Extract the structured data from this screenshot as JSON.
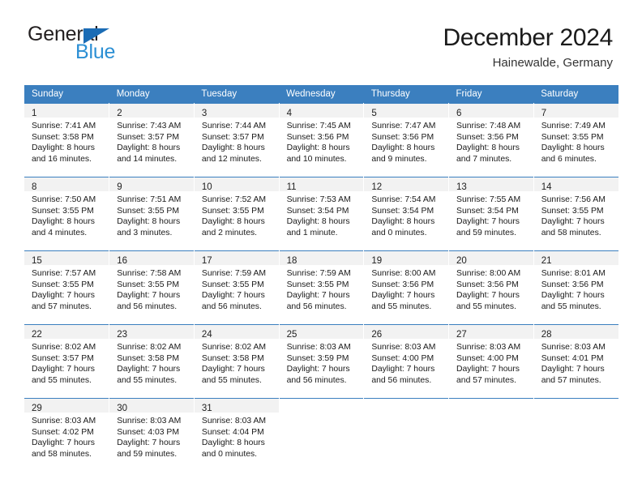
{
  "brand": {
    "name_part1": "General",
    "name_part2": "Blue"
  },
  "header": {
    "title": "December 2024",
    "subtitle": "Hainewalde, Germany"
  },
  "colors": {
    "header_blue": "#3b7fbf",
    "logo_blue": "#2b8fd4",
    "triangle_blue": "#1b6cb5",
    "daynum_strip": "#f2f2f2"
  },
  "weekday_headers": [
    "Sunday",
    "Monday",
    "Tuesday",
    "Wednesday",
    "Thursday",
    "Friday",
    "Saturday"
  ],
  "weeks": [
    [
      {
        "day": "1",
        "sunrise": "Sunrise: 7:41 AM",
        "sunset": "Sunset: 3:58 PM",
        "daylight1": "Daylight: 8 hours",
        "daylight2": "and 16 minutes."
      },
      {
        "day": "2",
        "sunrise": "Sunrise: 7:43 AM",
        "sunset": "Sunset: 3:57 PM",
        "daylight1": "Daylight: 8 hours",
        "daylight2": "and 14 minutes."
      },
      {
        "day": "3",
        "sunrise": "Sunrise: 7:44 AM",
        "sunset": "Sunset: 3:57 PM",
        "daylight1": "Daylight: 8 hours",
        "daylight2": "and 12 minutes."
      },
      {
        "day": "4",
        "sunrise": "Sunrise: 7:45 AM",
        "sunset": "Sunset: 3:56 PM",
        "daylight1": "Daylight: 8 hours",
        "daylight2": "and 10 minutes."
      },
      {
        "day": "5",
        "sunrise": "Sunrise: 7:47 AM",
        "sunset": "Sunset: 3:56 PM",
        "daylight1": "Daylight: 8 hours",
        "daylight2": "and 9 minutes."
      },
      {
        "day": "6",
        "sunrise": "Sunrise: 7:48 AM",
        "sunset": "Sunset: 3:56 PM",
        "daylight1": "Daylight: 8 hours",
        "daylight2": "and 7 minutes."
      },
      {
        "day": "7",
        "sunrise": "Sunrise: 7:49 AM",
        "sunset": "Sunset: 3:55 PM",
        "daylight1": "Daylight: 8 hours",
        "daylight2": "and 6 minutes."
      }
    ],
    [
      {
        "day": "8",
        "sunrise": "Sunrise: 7:50 AM",
        "sunset": "Sunset: 3:55 PM",
        "daylight1": "Daylight: 8 hours",
        "daylight2": "and 4 minutes."
      },
      {
        "day": "9",
        "sunrise": "Sunrise: 7:51 AM",
        "sunset": "Sunset: 3:55 PM",
        "daylight1": "Daylight: 8 hours",
        "daylight2": "and 3 minutes."
      },
      {
        "day": "10",
        "sunrise": "Sunrise: 7:52 AM",
        "sunset": "Sunset: 3:55 PM",
        "daylight1": "Daylight: 8 hours",
        "daylight2": "and 2 minutes."
      },
      {
        "day": "11",
        "sunrise": "Sunrise: 7:53 AM",
        "sunset": "Sunset: 3:54 PM",
        "daylight1": "Daylight: 8 hours",
        "daylight2": "and 1 minute."
      },
      {
        "day": "12",
        "sunrise": "Sunrise: 7:54 AM",
        "sunset": "Sunset: 3:54 PM",
        "daylight1": "Daylight: 8 hours",
        "daylight2": "and 0 minutes."
      },
      {
        "day": "13",
        "sunrise": "Sunrise: 7:55 AM",
        "sunset": "Sunset: 3:54 PM",
        "daylight1": "Daylight: 7 hours",
        "daylight2": "and 59 minutes."
      },
      {
        "day": "14",
        "sunrise": "Sunrise: 7:56 AM",
        "sunset": "Sunset: 3:55 PM",
        "daylight1": "Daylight: 7 hours",
        "daylight2": "and 58 minutes."
      }
    ],
    [
      {
        "day": "15",
        "sunrise": "Sunrise: 7:57 AM",
        "sunset": "Sunset: 3:55 PM",
        "daylight1": "Daylight: 7 hours",
        "daylight2": "and 57 minutes."
      },
      {
        "day": "16",
        "sunrise": "Sunrise: 7:58 AM",
        "sunset": "Sunset: 3:55 PM",
        "daylight1": "Daylight: 7 hours",
        "daylight2": "and 56 minutes."
      },
      {
        "day": "17",
        "sunrise": "Sunrise: 7:59 AM",
        "sunset": "Sunset: 3:55 PM",
        "daylight1": "Daylight: 7 hours",
        "daylight2": "and 56 minutes."
      },
      {
        "day": "18",
        "sunrise": "Sunrise: 7:59 AM",
        "sunset": "Sunset: 3:55 PM",
        "daylight1": "Daylight: 7 hours",
        "daylight2": "and 56 minutes."
      },
      {
        "day": "19",
        "sunrise": "Sunrise: 8:00 AM",
        "sunset": "Sunset: 3:56 PM",
        "daylight1": "Daylight: 7 hours",
        "daylight2": "and 55 minutes."
      },
      {
        "day": "20",
        "sunrise": "Sunrise: 8:00 AM",
        "sunset": "Sunset: 3:56 PM",
        "daylight1": "Daylight: 7 hours",
        "daylight2": "and 55 minutes."
      },
      {
        "day": "21",
        "sunrise": "Sunrise: 8:01 AM",
        "sunset": "Sunset: 3:56 PM",
        "daylight1": "Daylight: 7 hours",
        "daylight2": "and 55 minutes."
      }
    ],
    [
      {
        "day": "22",
        "sunrise": "Sunrise: 8:02 AM",
        "sunset": "Sunset: 3:57 PM",
        "daylight1": "Daylight: 7 hours",
        "daylight2": "and 55 minutes."
      },
      {
        "day": "23",
        "sunrise": "Sunrise: 8:02 AM",
        "sunset": "Sunset: 3:58 PM",
        "daylight1": "Daylight: 7 hours",
        "daylight2": "and 55 minutes."
      },
      {
        "day": "24",
        "sunrise": "Sunrise: 8:02 AM",
        "sunset": "Sunset: 3:58 PM",
        "daylight1": "Daylight: 7 hours",
        "daylight2": "and 55 minutes."
      },
      {
        "day": "25",
        "sunrise": "Sunrise: 8:03 AM",
        "sunset": "Sunset: 3:59 PM",
        "daylight1": "Daylight: 7 hours",
        "daylight2": "and 56 minutes."
      },
      {
        "day": "26",
        "sunrise": "Sunrise: 8:03 AM",
        "sunset": "Sunset: 4:00 PM",
        "daylight1": "Daylight: 7 hours",
        "daylight2": "and 56 minutes."
      },
      {
        "day": "27",
        "sunrise": "Sunrise: 8:03 AM",
        "sunset": "Sunset: 4:00 PM",
        "daylight1": "Daylight: 7 hours",
        "daylight2": "and 57 minutes."
      },
      {
        "day": "28",
        "sunrise": "Sunrise: 8:03 AM",
        "sunset": "Sunset: 4:01 PM",
        "daylight1": "Daylight: 7 hours",
        "daylight2": "and 57 minutes."
      }
    ],
    [
      {
        "day": "29",
        "sunrise": "Sunrise: 8:03 AM",
        "sunset": "Sunset: 4:02 PM",
        "daylight1": "Daylight: 7 hours",
        "daylight2": "and 58 minutes."
      },
      {
        "day": "30",
        "sunrise": "Sunrise: 8:03 AM",
        "sunset": "Sunset: 4:03 PM",
        "daylight1": "Daylight: 7 hours",
        "daylight2": "and 59 minutes."
      },
      {
        "day": "31",
        "sunrise": "Sunrise: 8:03 AM",
        "sunset": "Sunset: 4:04 PM",
        "daylight1": "Daylight: 8 hours",
        "daylight2": "and 0 minutes."
      },
      {
        "day": "",
        "sunrise": "",
        "sunset": "",
        "daylight1": "",
        "daylight2": ""
      },
      {
        "day": "",
        "sunrise": "",
        "sunset": "",
        "daylight1": "",
        "daylight2": ""
      },
      {
        "day": "",
        "sunrise": "",
        "sunset": "",
        "daylight1": "",
        "daylight2": ""
      },
      {
        "day": "",
        "sunrise": "",
        "sunset": "",
        "daylight1": "",
        "daylight2": ""
      }
    ]
  ]
}
